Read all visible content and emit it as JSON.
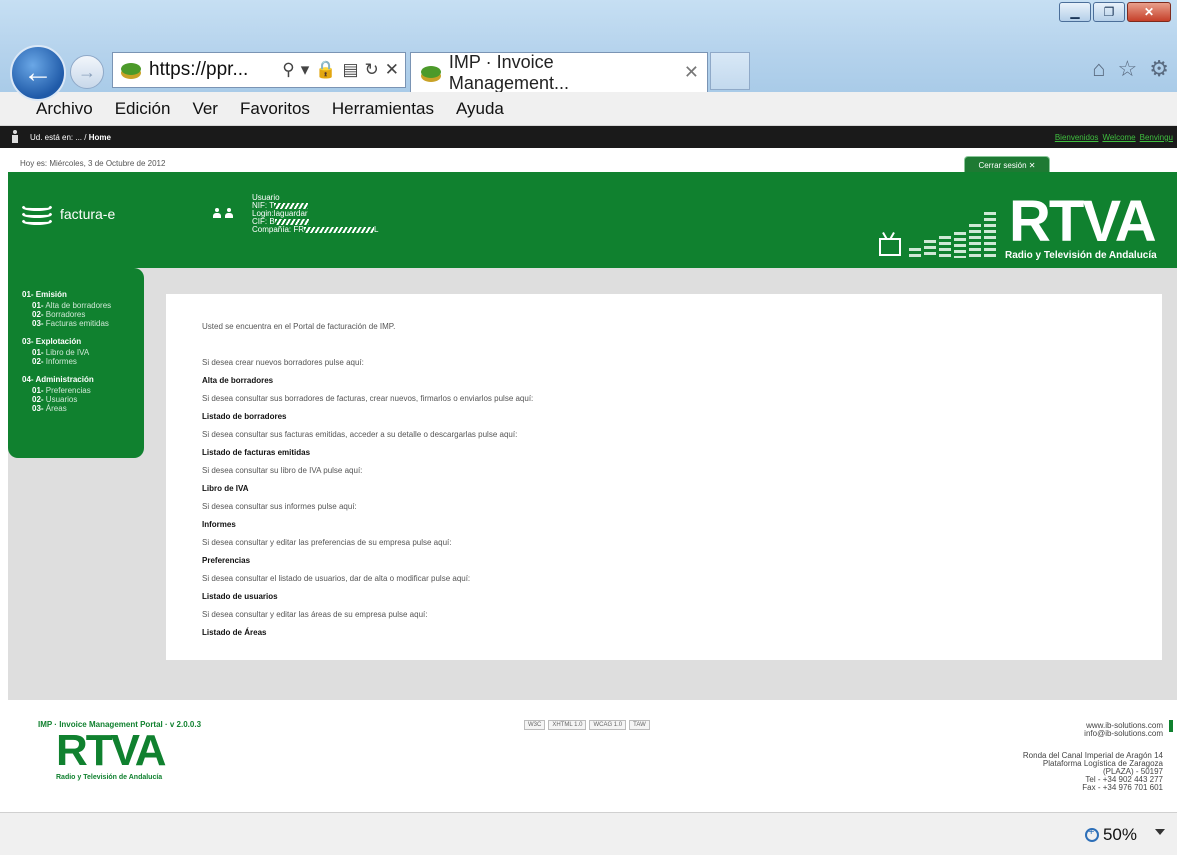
{
  "browser": {
    "address_url": "https://ppr...",
    "tab_title": "IMP · Invoice Management...",
    "menu": [
      "Archivo",
      "Edición",
      "Ver",
      "Favoritos",
      "Herramientas",
      "Ayuda"
    ],
    "zoom": "50%"
  },
  "topbar": {
    "breadcrumb_prefix": "Ud. está en: ... / ",
    "breadcrumb_current": "Home",
    "lang_links": [
      "Bienvenidos",
      "Welcome",
      "Benvingu"
    ]
  },
  "date_line": "Hoy es: Miércoles, 3 de Octubre de 2012",
  "logout_label": "Cerrar sesión ✕",
  "brand": {
    "name": "factura-e"
  },
  "user": {
    "line1": "Usuario",
    "line2": "NIF: T",
    "line3": "Login:laguardar",
    "line4": "CIF: B",
    "line5": "Compañía: FR"
  },
  "rtva": {
    "mark": "RTVA",
    "subtitle": "Radio y Televisión de Andalucía"
  },
  "sidebar": {
    "sections": [
      {
        "title": "01- Emisión",
        "items": [
          {
            "num": "01-",
            "label": "Alta de borradores"
          },
          {
            "num": "02-",
            "label": "Borradores"
          },
          {
            "num": "03-",
            "label": "Facturas emitidas"
          }
        ]
      },
      {
        "title": "03- Explotación",
        "items": [
          {
            "num": "01-",
            "label": "Libro de IVA"
          },
          {
            "num": "02-",
            "label": "Informes"
          }
        ]
      },
      {
        "title": "04- Administración",
        "items": [
          {
            "num": "01-",
            "label": "Preferencias"
          },
          {
            "num": "02-",
            "label": "Usuarios"
          },
          {
            "num": "03-",
            "label": "Áreas"
          }
        ]
      }
    ]
  },
  "main": {
    "intro": "Usted se encuentra en el Portal de facturación de IMP.",
    "blocks": [
      {
        "text": "Si desea crear nuevos borradores pulse aquí:",
        "link": "Alta de borradores"
      },
      {
        "text": "Si desea consultar sus borradores de facturas, crear nuevos, firmarlos o enviarlos pulse aquí:",
        "link": "Listado de borradores"
      },
      {
        "text": "Si desea consultar sus facturas emitidas, acceder a su detalle o descargarlas pulse aquí:",
        "link": "Listado de facturas emitidas"
      },
      {
        "text": "Si desea consultar su libro de IVA pulse aquí:",
        "link": "Libro de IVA"
      },
      {
        "text": "Si desea consultar sus informes pulse aquí:",
        "link": "Informes"
      },
      {
        "text": "Si desea consultar y editar las preferencias de su empresa pulse aquí:",
        "link": "Preferencias"
      },
      {
        "text": "Si desea consultar el listado de usuarios, dar de alta o modificar pulse aquí:",
        "link": "Listado de usuarios"
      },
      {
        "text": "Si desea consultar y editar las áreas de su empresa pulse aquí:",
        "link": "Listado de Áreas"
      }
    ]
  },
  "footer": {
    "version": "IMP · Invoice Management Portal · v 2.0.0.3",
    "logo_mark": "RTVA",
    "logo_sub": "Radio y Televisión de Andalucía",
    "badges": [
      "W3C",
      "XHTML 1.0",
      "WCAG 1.0",
      "TAW"
    ],
    "web": "www.ib-solutions.com",
    "email": "info@ib-solutions.com",
    "address": [
      "Ronda del Canal Imperial de Aragón 14",
      "Plataforma Logística de Zaragoza",
      "(PLAZA) - 50197",
      "Tel - +34 902 443 277",
      "Fax - +34 976 701 601"
    ]
  }
}
